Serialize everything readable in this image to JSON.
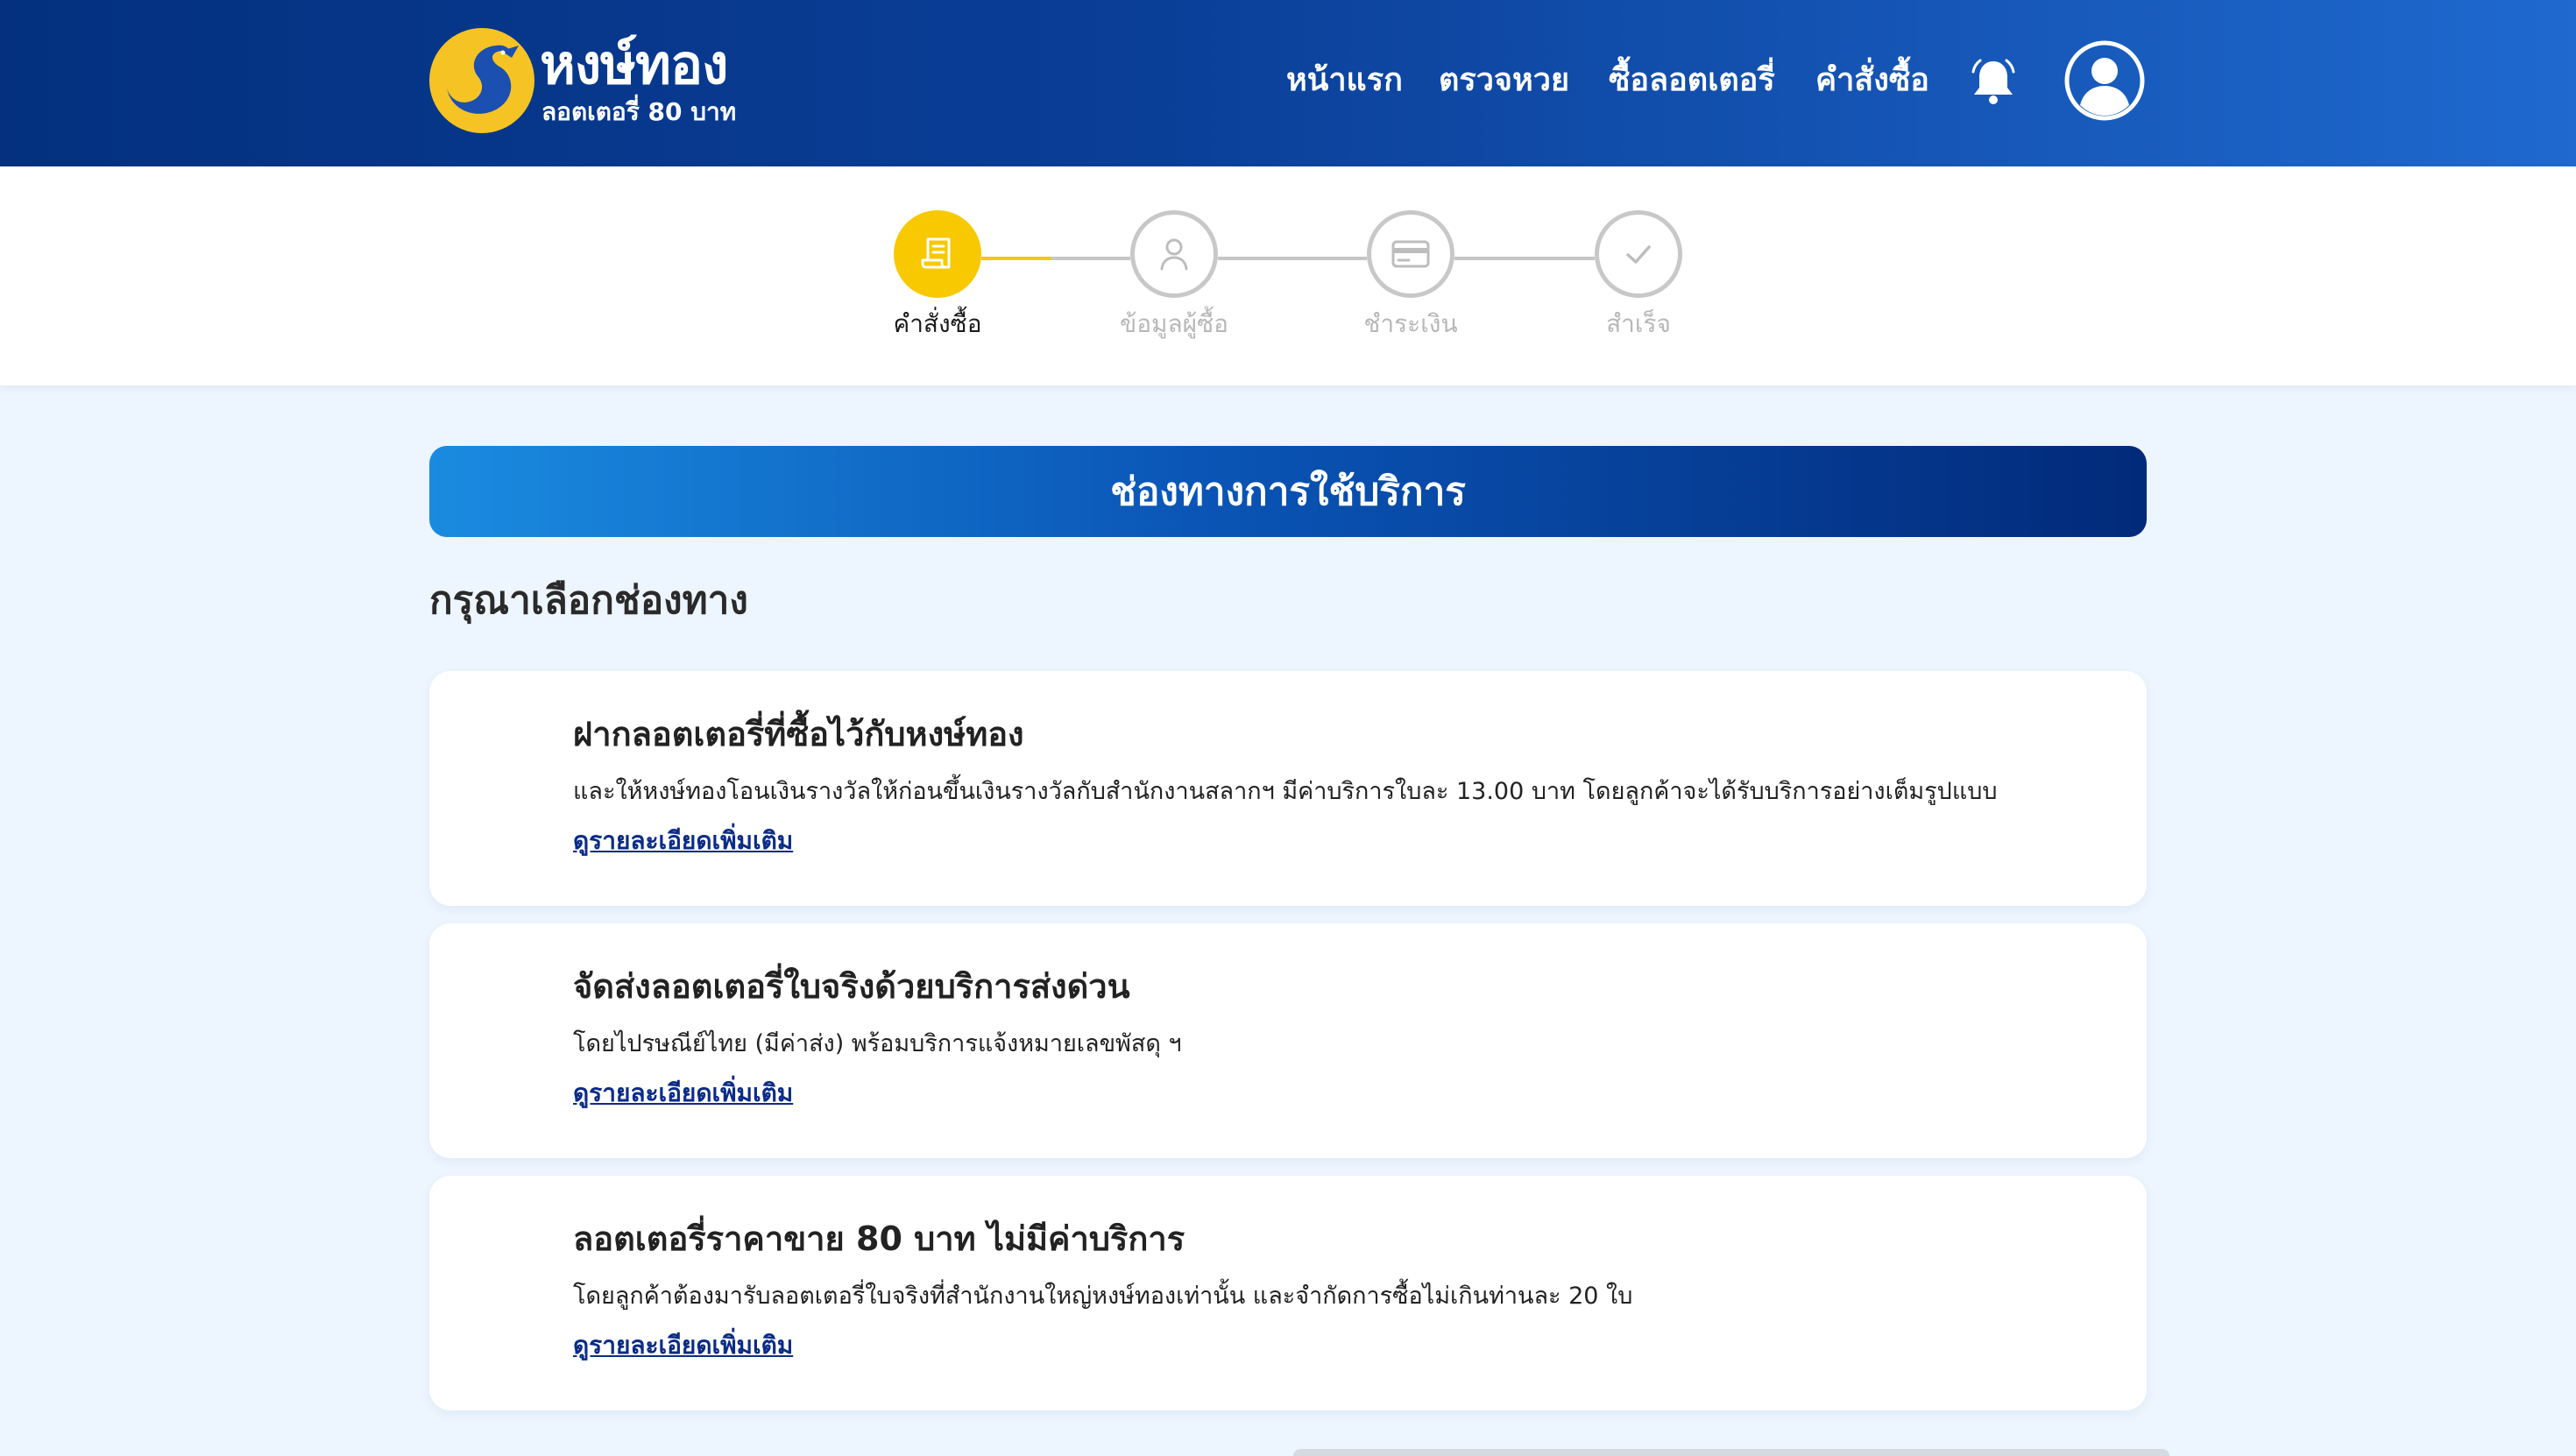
{
  "brand": {
    "name": "หงษ์ทอง",
    "tagline": "ลอตเตอรี่ 80 บาท",
    "colors": {
      "primary": "#0a3f98",
      "accent": "#f8c800"
    }
  },
  "nav": {
    "items": [
      {
        "label": "หน้าแรก"
      },
      {
        "label": "ตรวจหวย"
      },
      {
        "label": "ซื้อลอตเตอรี่"
      },
      {
        "label": "คำสั่งซื้อ"
      }
    ],
    "bell_icon": "bell-icon",
    "user_icon": "user-icon"
  },
  "stepper": {
    "steps": [
      {
        "label": "คำสั่งซื้อ",
        "icon": "document-icon",
        "active": true
      },
      {
        "label": "ข้อมูลผู้ซื้อ",
        "icon": "user-icon",
        "active": false
      },
      {
        "label": "ชำระเงิน",
        "icon": "credit-card-icon",
        "active": false
      },
      {
        "label": "สำเร็จ",
        "icon": "check-icon",
        "active": false
      }
    ]
  },
  "main": {
    "banner_title": "ช่องทางการใช้บริการ",
    "section_title": "กรุณาเลือกช่องทาง",
    "options": [
      {
        "title": "ฝากลอตเตอรี่ที่ซื้อไว้กับหงษ์ทอง",
        "description": "และให้หงษ์ทองโอนเงินรางวัลให้ก่อนขึ้นเงินรางวัลกับสำนักงานสลากฯ มีค่าบริการใบละ 13.00 บาท โดยลูกค้าจะได้รับบริการอย่างเต็มรูปแบบ",
        "link": "ดูรายละเอียดเพิ่มเติม"
      },
      {
        "title": "จัดส่งลอตเตอรี่ใบจริงด้วยบริการส่งด่วน",
        "description": "โดยไปรษณีย์ไทย (มีค่าส่ง) พร้อมบริการแจ้งหมายเลขพัสดุ ฯ",
        "link": "ดูรายละเอียดเพิ่มเติม"
      },
      {
        "title": "ลอตเตอรี่ราคาขาย 80 บาท ไม่มีค่าบริการ",
        "description": "โดยลูกค้าต้องมารับลอตเตอรี่ใบจริงที่สำนักงานใหญ่หงษ์ทองเท่านั้น และจำกัดการซื้อไม่เกินท่านละ 20 ใบ",
        "link": "ดูรายละเอียดเพิ่มเติม"
      }
    ]
  }
}
